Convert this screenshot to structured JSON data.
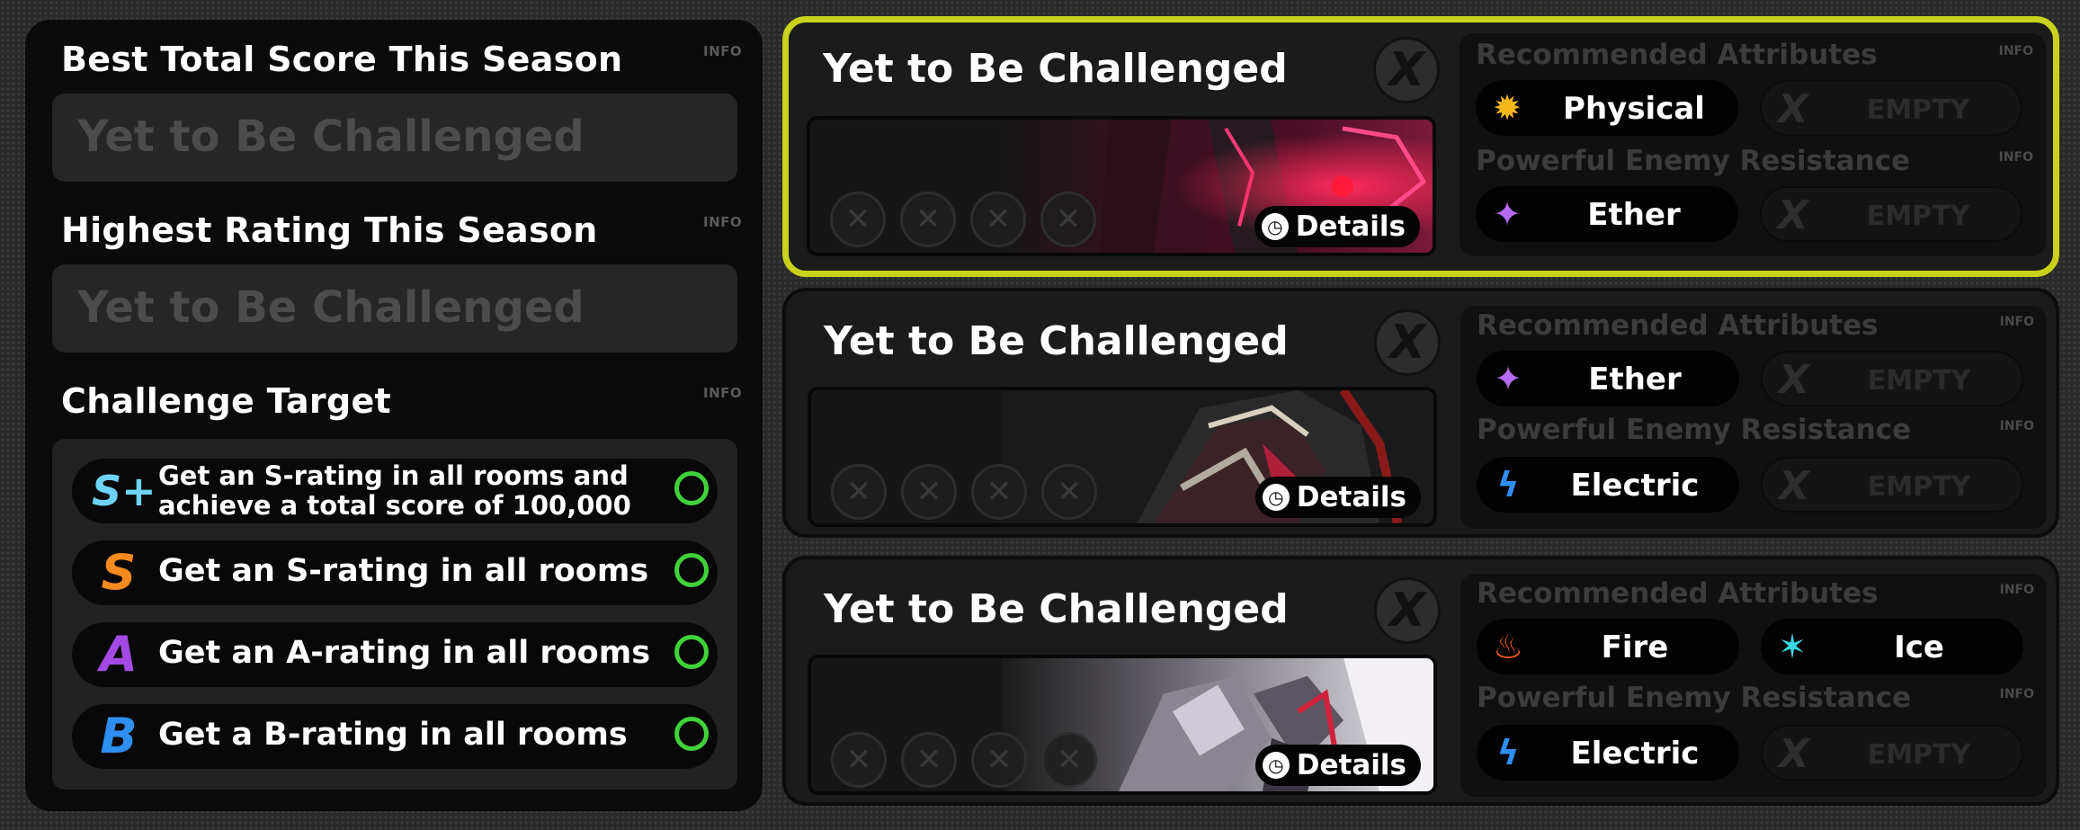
{
  "left": {
    "best_score": {
      "title": "Best Total Score This Season",
      "info": "INFO",
      "value": "Yet to Be Challenged"
    },
    "highest_rating": {
      "title": "Highest Rating This Season",
      "info": "INFO",
      "value": "Yet to Be Challenged"
    },
    "challenge_target": {
      "title": "Challenge Target",
      "info": "INFO",
      "rows": [
        {
          "rank": "S+",
          "color": "#6fd3f5",
          "line1": "Get an S-rating in all rooms and",
          "line2": "achieve a total score of 100,000"
        },
        {
          "rank": "S",
          "color": "#f58a1f",
          "text": "Get an S-rating in all rooms"
        },
        {
          "rank": "A",
          "color": "#a34ae6",
          "text": "Get an A-rating in all rooms"
        },
        {
          "rank": "B",
          "color": "#2f8ff0",
          "text": "Get a B-rating in all rooms"
        }
      ]
    }
  },
  "cards": [
    {
      "title": "Yet to Be Challenged",
      "x_icon": "X",
      "details": "Details",
      "details_icon": "clock-icon",
      "slot_icon": "✕",
      "recommended": {
        "title": "Recommended Attributes",
        "info": "INFO",
        "a": {
          "icon": "physical-icon",
          "label": "Physical",
          "glyph": "✹",
          "color": "#f6b81a"
        },
        "b": {
          "label": "EMPTY",
          "glyph": "X"
        }
      },
      "resistance": {
        "title": "Powerful Enemy Resistance",
        "info": "INFO",
        "a": {
          "icon": "ether-icon",
          "label": "Ether",
          "glyph": "✦",
          "color": "#b56af0"
        },
        "b": {
          "label": "EMPTY",
          "glyph": "X"
        }
      }
    },
    {
      "title": "Yet to Be Challenged",
      "x_icon": "X",
      "details": "Details",
      "details_icon": "clock-icon",
      "slot_icon": "✕",
      "recommended": {
        "title": "Recommended Attributes",
        "info": "INFO",
        "a": {
          "icon": "ether-icon",
          "label": "Ether",
          "glyph": "✦",
          "color": "#b56af0"
        },
        "b": {
          "label": "EMPTY",
          "glyph": "X"
        }
      },
      "resistance": {
        "title": "Powerful Enemy Resistance",
        "info": "INFO",
        "a": {
          "icon": "electric-icon",
          "label": "Electric",
          "glyph": "ϟ",
          "color": "#2d8ff5"
        },
        "b": {
          "label": "EMPTY",
          "glyph": "X"
        }
      }
    },
    {
      "title": "Yet to Be Challenged",
      "x_icon": "X",
      "details": "Details",
      "details_icon": "clock-icon",
      "slot_icon": "✕",
      "recommended": {
        "title": "Recommended Attributes",
        "info": "INFO",
        "a": {
          "icon": "fire-icon",
          "label": "Fire",
          "glyph": "♨",
          "color": "#f2541b"
        },
        "b": {
          "icon": "ice-icon",
          "label": "Ice",
          "glyph": "✶",
          "color": "#3ad6e6"
        }
      },
      "resistance": {
        "title": "Powerful Enemy Resistance",
        "info": "INFO",
        "a": {
          "icon": "electric-icon",
          "label": "Electric",
          "glyph": "ϟ",
          "color": "#2d8ff5"
        },
        "b": {
          "label": "EMPTY",
          "glyph": "X"
        }
      }
    }
  ],
  "colors": {
    "selected_border": "#c9d21a",
    "goal_ring": "#3fd23a"
  }
}
